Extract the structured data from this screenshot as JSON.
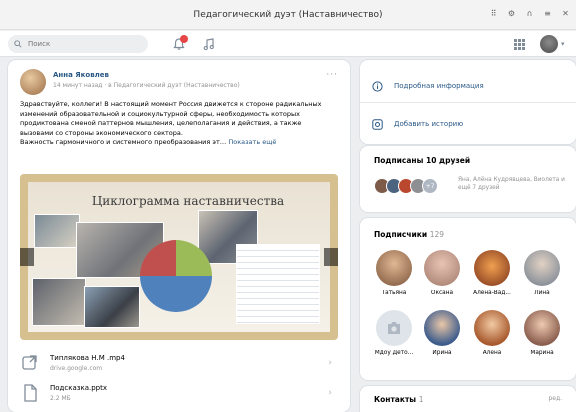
{
  "window": {
    "title": "Педагогический дуэт (Наставничество)"
  },
  "nav": {
    "search_placeholder": "Поиск"
  },
  "post": {
    "author": "Анна Яковлев",
    "meta": "14 минут назад · в Педагогический дуэт (Наставничество)",
    "more": "···",
    "text": "Здравствуйте, коллеги! В настоящий момент Россия движется к стороне радикальных изменений образовательной и социокультурной сферы, необходимость которых продиктована сменой паттернов мышления, целеполагания и действия, а также вызовами со стороны экономического сектора.",
    "text_last": "Важность гармоничного и системного преобразования эт…",
    "show_more": "Показать ещё",
    "slide_title": "Циклограмма наставничества",
    "attachments": [
      {
        "name": "Типлякова Н.М .mp4",
        "sub": "drive.google.com"
      },
      {
        "name": "Подсказка.pptx",
        "sub": "2.2 МБ"
      }
    ]
  },
  "sidebar": {
    "info_link": "Подробная информация",
    "history_link": "Добавить историю",
    "friends_title": "Подписаны 10 друзей",
    "friends_plus": "+7",
    "friends_text": "Яна, Алёна Кудрявцева, Виолета и ещё 7 друзей",
    "subscribers_title": "Подписчики",
    "subscribers_count": "129",
    "subscribers": [
      {
        "name": "Татьяна",
        "color": "#b07c5c"
      },
      {
        "name": "Оксана",
        "color": "#c29a8a"
      },
      {
        "name": "Алёна-Вад...",
        "color": "#b4612f"
      },
      {
        "name": "Лина",
        "color": "#8a98a8"
      },
      {
        "name": "Мдоу Дето...",
        "color": "#c8d0da"
      },
      {
        "name": "Ирина",
        "color": "#6e8eb8"
      },
      {
        "name": "Алена",
        "color": "#c47a52"
      },
      {
        "name": "Марина",
        "color": "#b7826a"
      }
    ],
    "contacts_title": "Контакты",
    "contacts_count": "1",
    "contacts_extra": "ред."
  }
}
